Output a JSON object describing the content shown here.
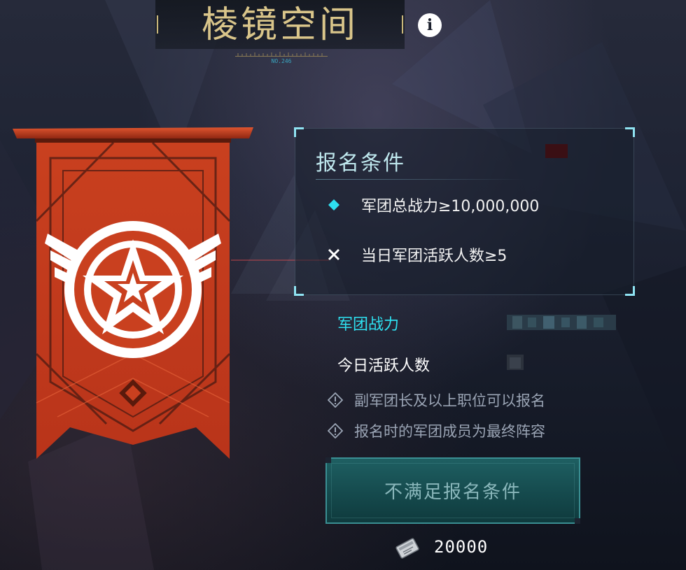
{
  "header": {
    "title": "棱镜空间",
    "serial": "NO.246",
    "info_icon": "info-icon"
  },
  "requirements": {
    "title": "报名条件",
    "items": [
      {
        "text": "军团总战力≥10,000,000",
        "status": "met",
        "icon": "diamond-check-icon",
        "color": "#2ee0f0"
      },
      {
        "text": "当日军团活跃人数≥5",
        "status": "unmet",
        "icon": "cross-icon",
        "color": "#ffffff"
      }
    ]
  },
  "stats": {
    "power_label": "军团战力",
    "active_label": "今日活跃人数"
  },
  "notes": [
    "副军团长及以上职位可以报名",
    "报名时的军团成员为最终阵容"
  ],
  "action": {
    "button_label": "不满足报名条件",
    "enabled": false
  },
  "cost": {
    "icon": "ticket-icon",
    "value": "20000"
  },
  "colors": {
    "accent_cyan": "#2ee0f0",
    "title_gold": "#d9c58a",
    "banner_red": "#c43a1c",
    "button_teal": "#1e5f62"
  }
}
